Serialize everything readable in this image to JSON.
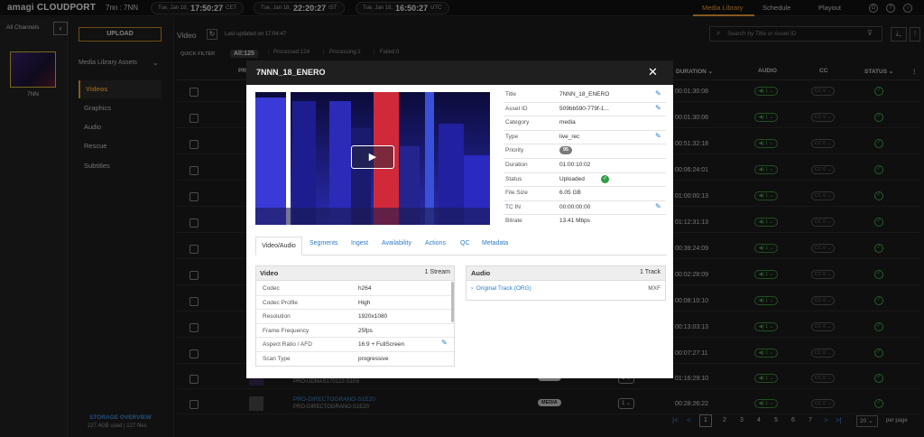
{
  "topbar": {
    "logo_prefix": "amagi",
    "logo_main": "CLOUDPORT",
    "channel_title": "7nn : 7NN",
    "clocks": [
      {
        "date": "Tue, Jan 18,",
        "time": "17:50:27",
        "zone": "CET"
      },
      {
        "date": "Tue, Jan 18,",
        "time": "22:20:27",
        "zone": "IST"
      },
      {
        "date": "Tue, Jan 18,",
        "time": "16:50:27",
        "zone": "UTC"
      }
    ],
    "nav": [
      "Media Library",
      "Schedule",
      "Playout"
    ],
    "icons": [
      "G",
      "?",
      "○"
    ]
  },
  "left_column": {
    "all_channels": "All Channels",
    "collapse_icon": "‹",
    "channel_label": "7NN"
  },
  "sidebar": {
    "upload": "UPLOAD",
    "section": "Media Library Assets",
    "items": [
      "Videos",
      "Graphics",
      "Audio",
      "Rescue",
      "Subtitles"
    ],
    "storage_title": "STORAGE OVERVIEW",
    "storage_sub": "227.4GB used | 127 files"
  },
  "main": {
    "title": "Video",
    "last_updated": "Last updated on 17:04:47",
    "search_placeholder": "Search by Title or Asset ID",
    "quick_filter_label": "QUICK FILTER",
    "filters": [
      "All:125",
      "Processed:124",
      "Processing:1",
      "Failed:0"
    ],
    "columns": {
      "preview": "PR",
      "duration": "DURATION ⌄",
      "audio": "AUDIO",
      "cc": "CC",
      "status": "STATUS ⌄"
    },
    "rows": [
      {
        "duration": "00:01:30:08",
        "audio": "◀) 1 ⌄",
        "cc": "CC 0 ⌄"
      },
      {
        "duration": "00:01:30:06",
        "audio": "◀) 1 ⌄",
        "cc": "CC 0 ⌄"
      },
      {
        "duration": "00:51:32:18",
        "audio": "◀) 1 ⌄",
        "cc": "CC 0 ⌄"
      },
      {
        "duration": "00:06:24:01",
        "audio": "◀) 1 ⌄",
        "cc": "CC 0 ⌄"
      },
      {
        "duration": "01:00:00:13",
        "audio": "◀) 1 ⌄",
        "cc": "CC 0 ⌄"
      },
      {
        "duration": "01:12:31:13",
        "audio": "◀) 1 ⌄",
        "cc": "CC 0 ⌄"
      },
      {
        "duration": "00:39:24:09",
        "audio": "◀) 1 ⌄",
        "cc": "CC 0 ⌄"
      },
      {
        "duration": "00:02:28:09",
        "audio": "◀) 1 ⌄",
        "cc": "CC 0 ⌄"
      },
      {
        "duration": "00:08:10:10",
        "audio": "◀) 1 ⌄",
        "cc": "CC 0 ⌄"
      },
      {
        "duration": "00:13:03:13",
        "audio": "◀) 1 ⌄",
        "cc": "CC 0 ⌄"
      },
      {
        "duration": "00:07:27:11",
        "audio": "◀) 1 ⌄",
        "cc": "CC 0 ⌄"
      },
      {
        "duration": "01:16:29:10",
        "audio": "◀) 1 ⌄",
        "cc": "CC 0 ⌄",
        "sub": "PRO-UDMAS170122-S1E6",
        "type": "MEDIA",
        "ver": "1 ⌄"
      },
      {
        "duration": "00:28:26:22",
        "audio": "◀) 1 ⌄",
        "cc": "CC 0 ⌄",
        "name": "PRO-DIRECTOGRANO-S1E20",
        "sub": "PRO-DIRECTOGRANO-S1E20",
        "type": "MEDIA",
        "ver": "1 ⌄"
      }
    ],
    "pager": {
      "pages": [
        "2",
        "3",
        "4",
        "5",
        "6",
        "7"
      ],
      "current": "1",
      "per_page": "20 ⌄",
      "per_page_label": "per page",
      "nav": [
        "|<",
        "<",
        ">",
        ">|"
      ]
    }
  },
  "modal": {
    "title": "7NNN_18_ENERO",
    "close_icon": "✕",
    "play_icon": "▶",
    "metadata": [
      {
        "k": "Title",
        "v": "7NNN_18_ENERO",
        "edit": true
      },
      {
        "k": "Asset ID",
        "v": "509bb590-779f-1...",
        "edit": true
      },
      {
        "k": "Category",
        "v": "media"
      },
      {
        "k": "Type",
        "v": "live_rec",
        "edit": true
      },
      {
        "k": "Priority",
        "v": "95"
      },
      {
        "k": "Duration",
        "v": "01:00:10:02"
      },
      {
        "k": "Status",
        "v": "Uploaded"
      },
      {
        "k": "File Size",
        "v": "6.05 GB"
      },
      {
        "k": "TC IN",
        "v": "00:00:00:00",
        "edit": true
      },
      {
        "k": "Bitrate",
        "v": "13.41 Mbps"
      }
    ],
    "tabs": [
      "Video/Audio",
      "Segments",
      "Ingest",
      "Availability",
      "Actions",
      "QC",
      "Metadata"
    ],
    "video_panel": {
      "title": "Video",
      "count": "1 Stream",
      "rows": [
        {
          "k": "Codec",
          "v": "h264"
        },
        {
          "k": "Codec Profile",
          "v": "High"
        },
        {
          "k": "Resolution",
          "v": "1920x1080"
        },
        {
          "k": "Frame Frequency",
          "v": "25fps"
        },
        {
          "k": "Aspect Ratio / AFD",
          "v": "16:9 + FullScreen",
          "edit": true
        },
        {
          "k": "Scan Type",
          "v": "progressive"
        }
      ]
    },
    "audio_panel": {
      "title": "Audio",
      "count": "1 Track",
      "track": "Original Track (ORG)",
      "format": "MXF"
    }
  }
}
